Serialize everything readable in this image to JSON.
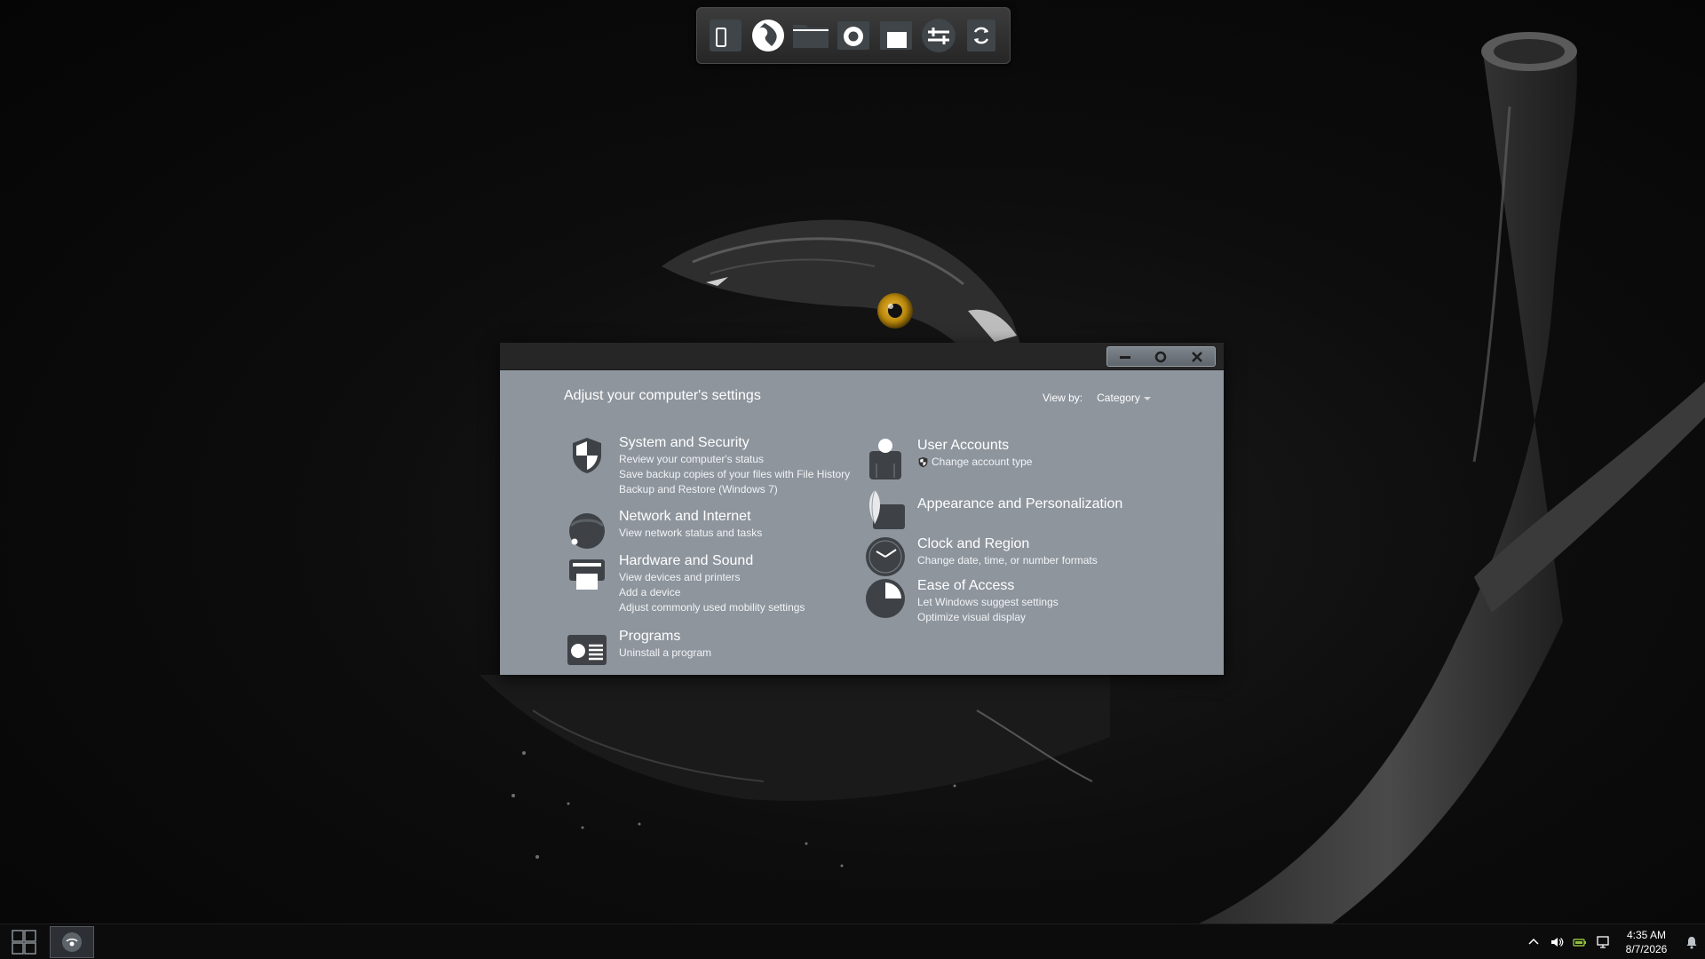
{
  "dock": {
    "items": [
      {
        "name": "phone",
        "icon": "phone-icon"
      },
      {
        "name": "browser",
        "icon": "globe-icon"
      },
      {
        "name": "folder",
        "icon": "folder-icon"
      },
      {
        "name": "camera",
        "icon": "camera-icon"
      },
      {
        "name": "files",
        "icon": "file-icon"
      },
      {
        "name": "settings",
        "icon": "sliders-icon"
      },
      {
        "name": "recycle",
        "icon": "recycle-icon"
      }
    ]
  },
  "window": {
    "controls": {
      "minimize": "minimize-icon",
      "restore": "restore-icon",
      "close": "close-icon"
    },
    "page_title": "Adjust your computer's settings",
    "view_by_label": "View by:",
    "view_by_value": "Category",
    "left_categories": [
      {
        "title": "System and Security",
        "icon": "shield-icon",
        "links": [
          "Review your computer's status",
          "Save backup copies of your files with File History",
          "Backup and Restore (Windows 7)"
        ]
      },
      {
        "title": "Network and Internet",
        "icon": "network-icon",
        "links": [
          "View network status and tasks"
        ]
      },
      {
        "title": "Hardware and Sound",
        "icon": "printer-icon",
        "links": [
          "View devices and printers",
          "Add a device",
          "Adjust commonly used mobility settings"
        ]
      },
      {
        "title": "Programs",
        "icon": "programs-icon",
        "links": [
          "Uninstall a program"
        ]
      }
    ],
    "right_categories": [
      {
        "title": "User Accounts",
        "icon": "user-icon",
        "links": [
          "Change account type"
        ]
      },
      {
        "title": "Appearance and Personalization",
        "icon": "appearance-icon",
        "links": []
      },
      {
        "title": "Clock and Region",
        "icon": "clock-icon",
        "links": [
          "Change date, time, or number formats"
        ]
      },
      {
        "title": "Ease of Access",
        "icon": "ease-of-access-icon",
        "links": [
          "Let Windows suggest settings",
          "Optimize visual display"
        ]
      }
    ]
  },
  "taskbar": {
    "clock_time": "4:35 AM",
    "clock_date": "8/7/2026",
    "tray_icons": [
      "chevron-up-icon",
      "volume-icon",
      "battery-icon",
      "network-icon"
    ],
    "notification_icon": "notification-icon"
  },
  "colors": {
    "window_bg": "#8e959d",
    "titlebar_bg": "#262626",
    "taskbar_bg": "#0c0c0c",
    "eagle_eye": "#c99a1a"
  }
}
